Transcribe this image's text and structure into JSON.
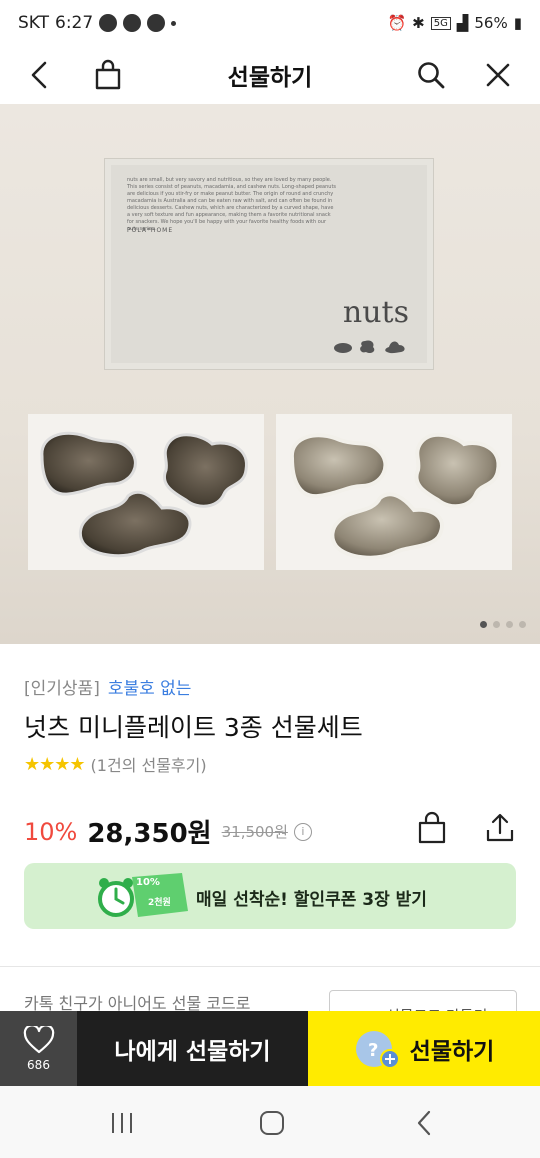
{
  "status_bar": {
    "carrier": "SKT",
    "time": "6:27",
    "battery": "56%",
    "network": "5G"
  },
  "header": {
    "title": "선물하기"
  },
  "hero": {
    "box_word": "nuts",
    "box_brand": "POLA*HOME",
    "box_copy": "nuts are small, but very savory and nutritious, so they are loved by many people. This series consist of peanuts, macadamia, and cashew nuts. Long-shaped peanuts are delicious if you stir-fry or make peanut butter. The origin of round and crunchy macadamia is Australia and can be eaten raw with salt, and can often be found in delicious desserts. Cashew nuts, which are characterized by a curved shape, have a very soft texture and fun appearance, making them a favorite nutritional snack for snackers. We hope you'll be happy with your favorite healthy foods with our nuts series.",
    "carousel_total": 4,
    "carousel_active": 1
  },
  "product": {
    "category": "[인기상품]",
    "badge": "호불호 없는",
    "name": "넛츠 미니플레이트 3종 선물세트",
    "stars": "★★★★",
    "review_text": "(1건의 선물후기)",
    "discount": "10%",
    "price": "28,350원",
    "original_price": "31,500원",
    "info_symbol": "i"
  },
  "coupon": {
    "label": "매일 선착순! 할인쿠폰 3장 받기",
    "art_percent": "10%",
    "art_amount": "2천원"
  },
  "gift_code": {
    "note": "카톡 친구가 아니어도 선물 코드로",
    "button_label": "선물코드 만들기"
  },
  "bottom_bar": {
    "wish_count": "686",
    "self_gift_label": "나에게 선물하기",
    "send_gift_label": "선물하기"
  },
  "colors": {
    "accent_yellow": "#ffeb00",
    "discount_red": "#f04a3e",
    "badge_blue": "#3b7ee0",
    "coupon_green": "#d5f0cf"
  }
}
